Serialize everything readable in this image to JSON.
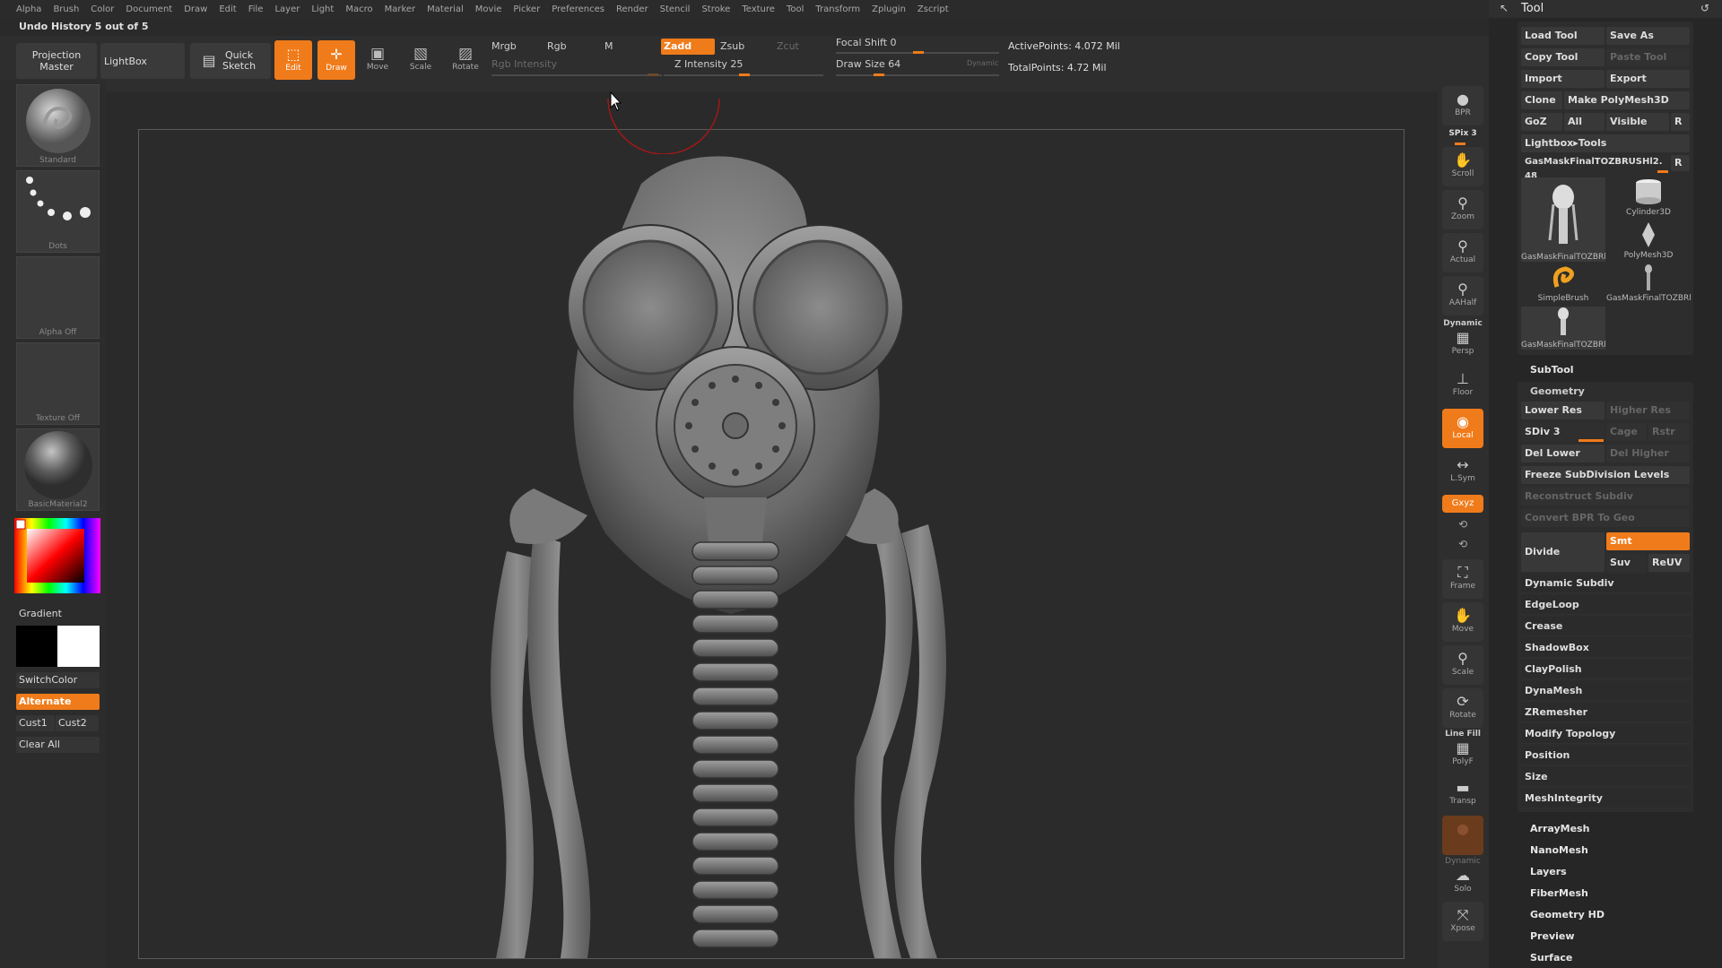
{
  "menu": [
    "Alpha",
    "Brush",
    "Color",
    "Document",
    "Draw",
    "Edit",
    "File",
    "Layer",
    "Light",
    "Macro",
    "Marker",
    "Material",
    "Movie",
    "Picker",
    "Preferences",
    "Render",
    "Stencil",
    "Stroke",
    "Texture",
    "Tool",
    "Transform",
    "Zplugin",
    "Zscript"
  ],
  "undo_history": "Undo History 5 out of 5",
  "shelf": {
    "projection_master": "Projection Master",
    "lightbox": "LightBox",
    "quick_sketch": "Quick Sketch",
    "edit": "Edit",
    "draw": "Draw",
    "move": "Move",
    "scale": "Scale",
    "rotate": "Rotate",
    "mrgb": "Mrgb",
    "rgb": "Rgb",
    "m": "M",
    "rgb_intensity": "Rgb Intensity",
    "zadd": "Zadd",
    "zsub": "Zsub",
    "zcut": "Zcut",
    "z_intensity": "Z Intensity 25",
    "focal_shift": "Focal Shift 0",
    "draw_size": "Draw Size 64",
    "dynamic": "Dynamic",
    "active_points": "ActivePoints: 4.072 Mil",
    "total_points": "TotalPoints: 4.72 Mil"
  },
  "left": {
    "brush_label": "Standard",
    "stroke_label": "Dots",
    "alpha_label": "Alpha Off",
    "texture_label": "Texture Off",
    "material_label": "BasicMaterial2",
    "gradient": "Gradient",
    "switch_color": "SwitchColor",
    "alternate": "Alternate",
    "cust1": "Cust1",
    "cust2": "Cust2",
    "clear_all": "Clear All"
  },
  "rightshelf": {
    "bpr": "BPR",
    "spix": "SPix 3",
    "scroll": "Scroll",
    "zoom": "Zoom",
    "actual": "Actual",
    "aahalf": "AAHalf",
    "dynamic": "Dynamic",
    "persp": "Persp",
    "floor": "Floor",
    "local": "Local",
    "lsym": "L.Sym",
    "xyz": "Gxyz",
    "frame": "Frame",
    "move": "Move",
    "scale": "Scale",
    "rotate": "Rotate",
    "line_fill": "Line Fill",
    "polyf": "PolyF",
    "transp": "Transp",
    "dynamic2": "Dynamic",
    "solo": "Solo",
    "xpose": "Xpose"
  },
  "tool": {
    "title": "Tool",
    "load_tool": "Load Tool",
    "save_as": "Save As",
    "copy_tool": "Copy Tool",
    "paste_tool": "Paste Tool",
    "import": "Import",
    "export": "Export",
    "clone": "Clone",
    "make_polymesh": "Make PolyMesh3D",
    "goz": "GoZ",
    "all": "All",
    "visible": "Visible",
    "r": "R",
    "lightbox_tools": "Lightbox▸Tools",
    "current_tool": "GasMaskFinalTOZBRUSHl2. 48",
    "thumbs": [
      "GasMaskFinalTOZBRl",
      "Cylinder3D",
      "PolyMesh3D",
      "SimpleBrush",
      "GasMaskFinalTOZBRl",
      "GasMaskFinalTOZBRl"
    ],
    "subtool": "SubTool",
    "geometry": "Geometry",
    "lower_res": "Lower Res",
    "higher_res": "Higher Res",
    "sdiv": "SDiv 3",
    "cage": "Cage",
    "rstr": "Rstr",
    "del_lower": "Del Lower",
    "del_higher": "Del Higher",
    "freeze": "Freeze SubDivision Levels",
    "reconstruct": "Reconstruct Subdiv",
    "convert_bpr": "Convert BPR To Geo",
    "divide": "Divide",
    "smt": "Smt",
    "suv": "Suv",
    "reuv": "ReUV",
    "geometry_rows": [
      "Dynamic Subdiv",
      "EdgeLoop",
      "Crease",
      "ShadowBox",
      "ClayPolish",
      "DynaMesh",
      "ZRemesher",
      "Modify Topology",
      "Position",
      "Size",
      "MeshIntegrity"
    ],
    "sections": [
      "ArrayMesh",
      "NanoMesh",
      "Layers",
      "FiberMesh",
      "Geometry HD",
      "Preview",
      "Surface"
    ]
  }
}
